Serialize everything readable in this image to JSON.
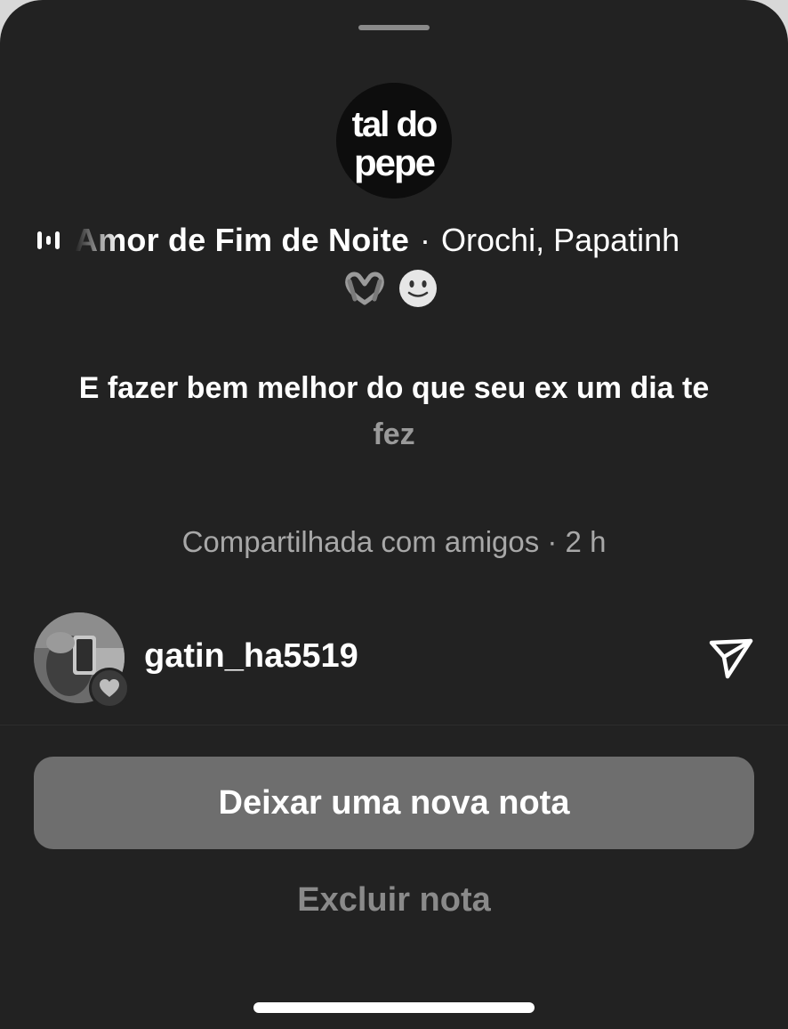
{
  "note": {
    "album_art_text": [
      "tal do",
      "pepe"
    ],
    "music": {
      "track": "Amor de Fim de Noite",
      "separator": "·",
      "artists": "Orochi, Papatinh",
      "icon": "audio-bars-icon"
    },
    "emojis": [
      "heart-hands-icon",
      "slightly-smiling-face-icon"
    ],
    "lyric_main": "E fazer bem melhor do que seu ex um dia te",
    "lyric_dim": "fez",
    "shared_label": "Compartilhada com amigos · 2 h"
  },
  "user": {
    "username": "gatin_ha5519",
    "badge_icon": "heart-icon",
    "action_icon": "send-icon"
  },
  "actions": {
    "primary_label": "Deixar uma nova nota",
    "delete_label": "Excluir nota"
  }
}
